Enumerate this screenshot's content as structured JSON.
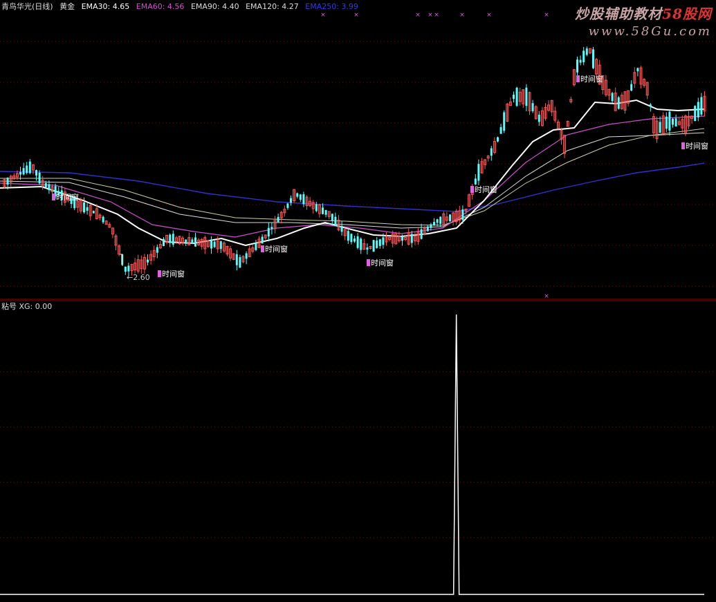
{
  "header": {
    "stock": "青鸟华光(日线)",
    "title": "黄金",
    "ema30": "EMA30: 4.65",
    "ema60": "EMA60: 4.56",
    "ema90": "EMA90: 4.40",
    "ema120": "EMA120: 4.27",
    "ema250": "EMA250: 3.99"
  },
  "colors": {
    "ema30": "#ffffff",
    "ema60": "#d050d0",
    "ema90": "#dddddd",
    "ema120": "#d0d0a0",
    "ema250": "#3030d0",
    "up": "#ff5555",
    "down": "#55ffff",
    "divider": "#8b0000",
    "grid": "#8b0000"
  },
  "watermark": {
    "line1_a": "炒股辅助教材",
    "line1_b": "58股网",
    "line2": "www.58Gu.com"
  },
  "main_chart": {
    "min_price_label": "2.60",
    "time_window_label": "时间窗"
  },
  "sub_panel": {
    "header": "粘号  XG: 0.00"
  },
  "chart_data": {
    "type": "line",
    "title": "粘号 XG",
    "series": [
      {
        "name": "XG",
        "spike_position_fraction": 0.648,
        "spike_value": 1,
        "baseline": 0
      }
    ]
  }
}
